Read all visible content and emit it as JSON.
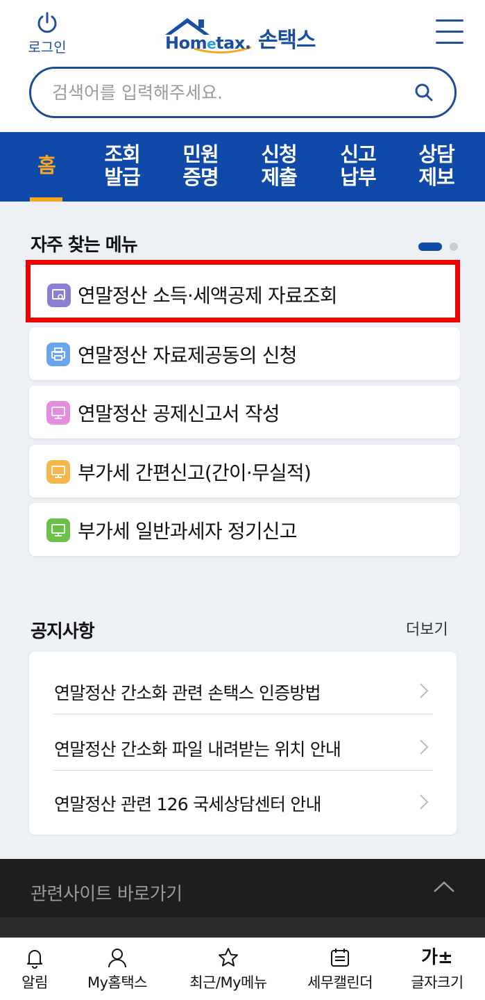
{
  "header": {
    "login_label": "로그인",
    "logo_text_a": "Hom",
    "logo_text_e": "e",
    "logo_text_b": "tax.",
    "logo_sub": "손택스",
    "search_placeholder": "검색어를 입력해주세요."
  },
  "nav": {
    "items": [
      {
        "line1": "홈",
        "line2": ""
      },
      {
        "line1": "조회",
        "line2": "발급"
      },
      {
        "line1": "민원",
        "line2": "증명"
      },
      {
        "line1": "신청",
        "line2": "제출"
      },
      {
        "line1": "신고",
        "line2": "납부"
      },
      {
        "line1": "상담",
        "line2": "제보"
      }
    ],
    "active_index": 0
  },
  "favorites": {
    "title": "자주 찾는 메뉴",
    "page_count": 2,
    "current_page": 1,
    "items": [
      {
        "label": "연말정산 소득·세액공제 자료조회",
        "icon": "search-doc-icon",
        "color": "#8a7fd0"
      },
      {
        "label": "연말정산 자료제공동의 신청",
        "icon": "printer-icon",
        "color": "#6aa6f0"
      },
      {
        "label": "연말정산 공제신고서 작성",
        "icon": "monitor-icon",
        "color": "#e58ee0"
      },
      {
        "label": "부가세 간편신고(간이·무실적)",
        "icon": "monitor-icon",
        "color": "#f2b84b"
      },
      {
        "label": "부가세 일반과세자 정기신고",
        "icon": "monitor-icon",
        "color": "#6cc04a"
      }
    ]
  },
  "notices": {
    "title": "공지사항",
    "more_label": "더보기",
    "items": [
      "연말정산 간소화 관련 손택스 인증방법",
      "연말정산 간소화 파일 내려받는 위치 안내",
      "연말정산 관련 126 국세상담센터 안내"
    ]
  },
  "related": {
    "label": "관련사이트 바로가기"
  },
  "tabbar": {
    "items": [
      {
        "label": "알림",
        "icon": "bell-icon"
      },
      {
        "label": "My홈택스",
        "icon": "person-icon"
      },
      {
        "label": "최근/My메뉴",
        "icon": "star-icon"
      },
      {
        "label": "세무캘린더",
        "icon": "calendar-icon"
      },
      {
        "label": "글자크기",
        "icon": "font-size-icon",
        "glyph": "가±"
      }
    ]
  },
  "colors": {
    "brand_blue": "#0f4aa8",
    "accent_orange": "#f5a623",
    "highlight_red": "#ee0000"
  }
}
